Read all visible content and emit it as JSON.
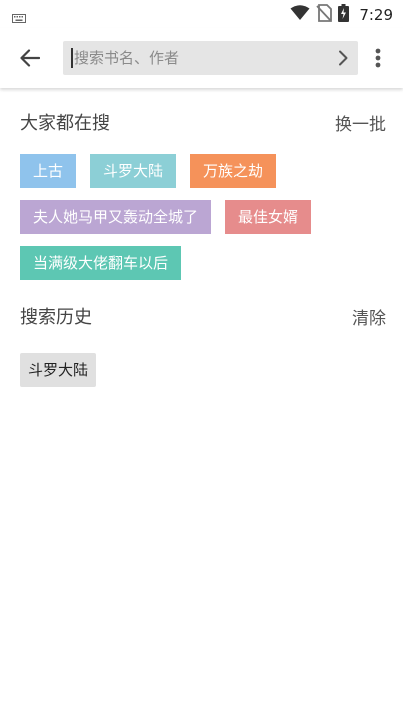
{
  "status_bar": {
    "time": "7:29",
    "icons": [
      "keyboard-icon",
      "wifi-icon",
      "no-sim-icon",
      "battery-charging-icon"
    ]
  },
  "toolbar": {
    "search_placeholder": "搜索书名、作者",
    "search_value": ""
  },
  "hot_search": {
    "title": "大家都在搜",
    "action": "换一批",
    "tags": [
      {
        "label": "上古",
        "color": "#8fc3ec"
      },
      {
        "label": "斗罗大陆",
        "color": "#8ccfd6"
      },
      {
        "label": "万族之劫",
        "color": "#f5925a"
      },
      {
        "label": "夫人她马甲又轰动全城了",
        "color": "#bba6d3"
      },
      {
        "label": "最佳女婿",
        "color": "#e68c8c"
      },
      {
        "label": "当满级大佬翻车以后",
        "color": "#5dc7b3"
      }
    ]
  },
  "history": {
    "title": "搜索历史",
    "action": "清除",
    "items": [
      "斗罗大陆"
    ]
  }
}
